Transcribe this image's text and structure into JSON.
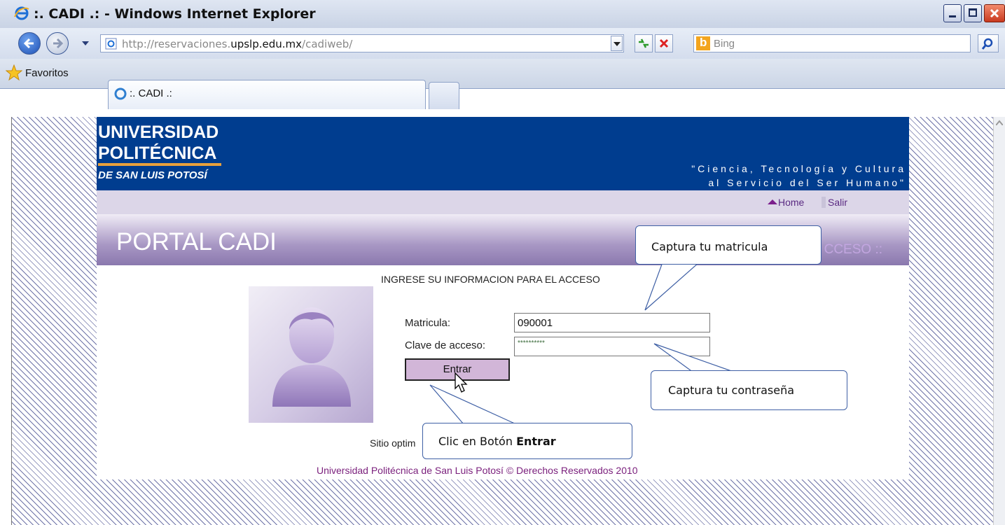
{
  "window": {
    "title": ":. CADI .: - Windows Internet Explorer"
  },
  "addressbar": {
    "url_prefix": "http://reservaciones.",
    "url_domain": "upslp.edu.mx",
    "url_path": "/cadiweb/",
    "search_placeholder": "Bing"
  },
  "favorites": {
    "label": "Favoritos"
  },
  "tabs": [
    {
      "label": ":. CADI .:"
    }
  ],
  "header": {
    "logo_line1": "UNIVERSIDAD",
    "logo_line2": "POLITÉCNICA",
    "logo_line3": "DE SAN LUIS POTOSÍ",
    "motto_line1": "\"Ciencia, Tecnología y Cultura",
    "motto_line2": "al Servicio del Ser Humano\""
  },
  "nav": {
    "home": "Home",
    "salir": "Salir"
  },
  "banner": {
    "title": "PORTAL CADI",
    "right": "CCESO ::"
  },
  "form": {
    "instruction": "INGRESE SU INFORMACION PARA EL ACCESO",
    "matricula_label": "Matricula:",
    "matricula_value": "090001",
    "clave_label": "Clave de acceso:",
    "clave_value": "**********",
    "submit": "Entrar"
  },
  "sitio_text": "Sitio optim",
  "footer": "Universidad Politécnica de San Luis Potosí © Derechos Reservados 2010",
  "callouts": {
    "matricula": "Captura tu matricula",
    "contrasena": "Captura tu contraseña",
    "entrar_prefix": "Clic en Botón ",
    "entrar_bold": "Entrar"
  },
  "colors": {
    "header_blue": "#003d8f",
    "accent_purple": "#7a1f7c",
    "callout_border": "#3f60a5"
  }
}
